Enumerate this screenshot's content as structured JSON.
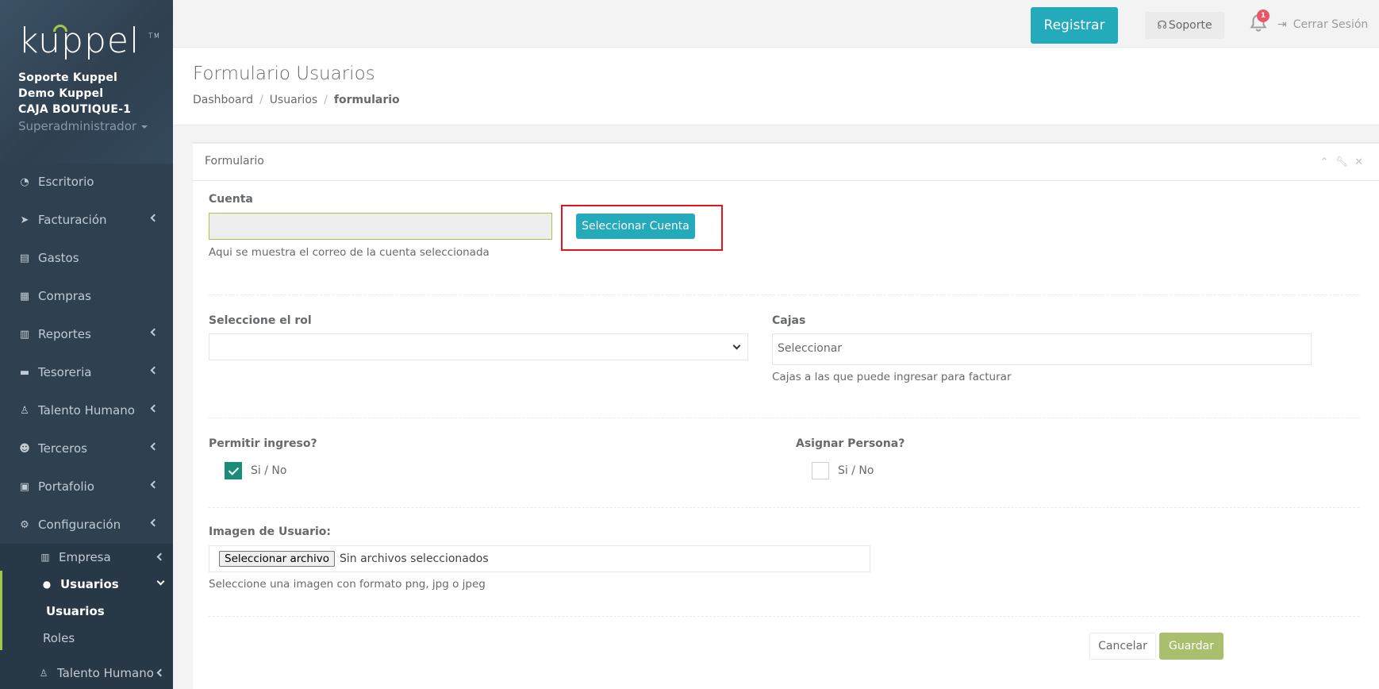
{
  "sidebar": {
    "logo": "kuppel",
    "profile": [
      "Soporte Kuppel",
      "Demo Kuppel",
      "CAJA BOUTIQUE-1"
    ],
    "role": "Superadministrador",
    "items": [
      {
        "label": "Escritorio",
        "icon": "pie-chart-icon"
      },
      {
        "label": "Facturación",
        "icon": "paper-plane-icon"
      },
      {
        "label": "Gastos",
        "icon": "receipt-icon"
      },
      {
        "label": "Compras",
        "icon": "boxes-icon"
      },
      {
        "label": "Reportes",
        "icon": "bar-chart-icon"
      },
      {
        "label": "Tesoreria",
        "icon": "wallet-icon"
      },
      {
        "label": "Talento Humano",
        "icon": "user-tie-icon"
      },
      {
        "label": "Terceros",
        "icon": "users-icon"
      },
      {
        "label": "Portafolio",
        "icon": "briefcase-icon"
      },
      {
        "label": "Configuración",
        "icon": "gear-icon"
      }
    ],
    "sub": {
      "empresa": "Empresa",
      "usuarios": "Usuarios",
      "usuarios_child": "Usuarios",
      "roles": "Roles",
      "talento": "Talento Humano"
    }
  },
  "topbar": {
    "register": "Registrar",
    "support": "Soporte",
    "notifications": "1",
    "logout": "Cerrar Sesión"
  },
  "page": {
    "title": "Formulario Usuarios",
    "breadcrumb": [
      "Dashboard",
      "Usuarios",
      "formulario"
    ]
  },
  "form": {
    "panel_title": "Formulario",
    "cuenta_label": "Cuenta",
    "cuenta_value": "",
    "select_account": "Seleccionar Cuenta",
    "cuenta_help": "Aqui se muestra el correo de la cuenta seleccionada",
    "rol_label": "Seleccione el rol",
    "rol_value": "",
    "cajas_label": "Cajas",
    "cajas_placeholder": "Seleccionar",
    "cajas_help": "Cajas a las que puede ingresar para facturar",
    "permitir_label": "Permitir ingreso?",
    "permitir_checked": true,
    "asignar_label": "Asignar Persona?",
    "asignar_checked": false,
    "si_no": "Si  /  No",
    "imagen_label": "Imagen de Usuario:",
    "file_button": "Seleccionar archivo",
    "file_status": "Sin archivos seleccionados",
    "imagen_help": "Seleccione una imagen con formato png, jpg o jpeg",
    "cancel": "Cancelar",
    "save": "Guardar"
  },
  "colors": {
    "sidebar": "#2f4050",
    "accent": "#23aabb",
    "green": "#a3c64d",
    "highlight": "#e8141c"
  }
}
